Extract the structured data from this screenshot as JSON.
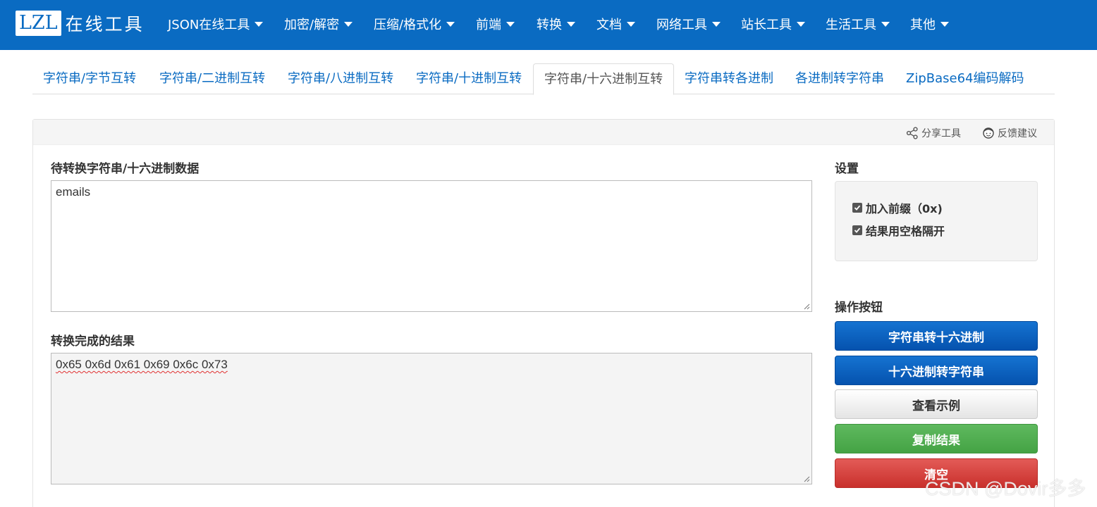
{
  "logo": {
    "brand": "LZL",
    "suffix": "在线工具"
  },
  "nav": {
    "items": [
      {
        "label": "JSON在线工具"
      },
      {
        "label": "加密/解密"
      },
      {
        "label": "压缩/格式化"
      },
      {
        "label": "前端"
      },
      {
        "label": "转换"
      },
      {
        "label": "文档"
      },
      {
        "label": "网络工具"
      },
      {
        "label": "站长工具"
      },
      {
        "label": "生活工具"
      },
      {
        "label": "其他"
      }
    ]
  },
  "tabs": [
    {
      "label": "字符串/字节互转"
    },
    {
      "label": "字符串/二进制互转"
    },
    {
      "label": "字符串/八进制互转"
    },
    {
      "label": "字符串/十进制互转"
    },
    {
      "label": "字符串/十六进制互转",
      "active": true
    },
    {
      "label": "字符串转各进制"
    },
    {
      "label": "各进制转字符串"
    },
    {
      "label": "ZipBase64编码解码"
    }
  ],
  "panel": {
    "share_label": "分享工具",
    "feedback_label": "反馈建议"
  },
  "input": {
    "label": "待转换字符串/十六进制数据",
    "value": "emails"
  },
  "output": {
    "label": "转换完成的结果",
    "value": "0x65 0x6d 0x61 0x69 0x6c 0x73"
  },
  "settings": {
    "title": "设置",
    "prefix_label": "加入前缀（0x)",
    "prefix_checked": true,
    "space_label": "结果用空格隔开",
    "space_checked": true
  },
  "actions": {
    "title": "操作按钮",
    "str_to_hex": "字符串转十六进制",
    "hex_to_str": "十六进制转字符串",
    "example": "查看示例",
    "copy": "复制结果",
    "clear": "清空"
  },
  "watermark": "CSDN @Dovir多多",
  "colors": {
    "navbar": "#0a6bc2",
    "primary_button": "#0b62c4",
    "success_button": "#4cae4c",
    "danger_button": "#d9534f",
    "link": "#0a6bc2"
  }
}
